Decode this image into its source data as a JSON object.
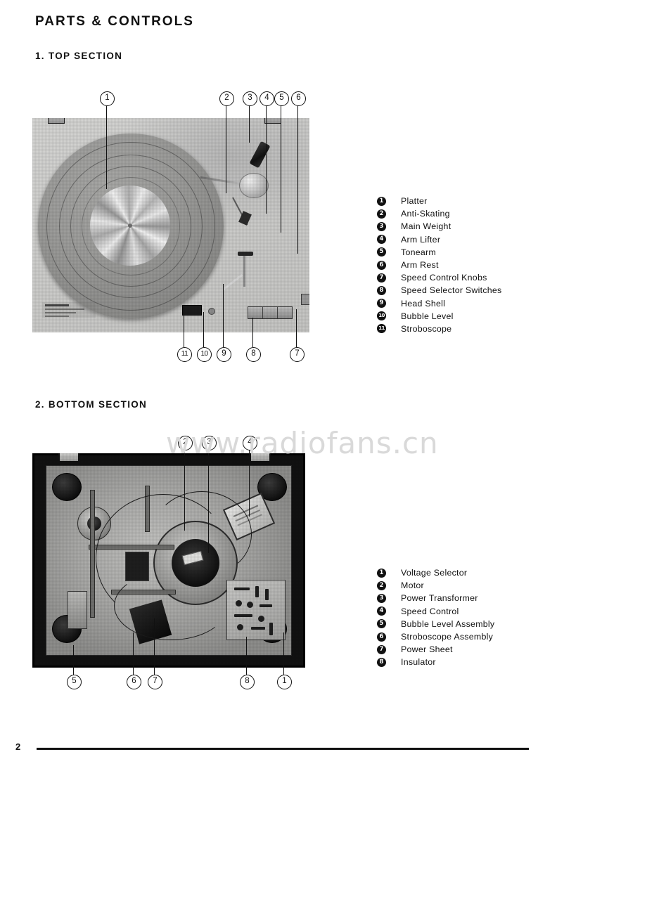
{
  "page": {
    "title": "PARTS & CONTROLS",
    "number": "2",
    "watermark": "www.radiofans.cn"
  },
  "sections": [
    {
      "heading": "1. TOP SECTION",
      "legend": [
        {
          "num": "1",
          "label": "Platter"
        },
        {
          "num": "2",
          "label": "Anti-Skating"
        },
        {
          "num": "3",
          "label": "Main Weight"
        },
        {
          "num": "4",
          "label": "Arm  Lifter"
        },
        {
          "num": "5",
          "label": "Tonearm"
        },
        {
          "num": "6",
          "label": "Arm  Rest"
        },
        {
          "num": "7",
          "label": "Speed Control Knobs"
        },
        {
          "num": "8",
          "label": "Speed Selector Switches"
        },
        {
          "num": "9",
          "label": "Head Shell"
        },
        {
          "num": "10",
          "label": "Bubble  Level"
        },
        {
          "num": "11",
          "label": "Stroboscope"
        }
      ],
      "callouts_top": [
        "1",
        "2",
        "3",
        "4",
        "5",
        "6"
      ],
      "callouts_bottom": [
        "11",
        "10",
        "9",
        "8",
        "7"
      ]
    },
    {
      "heading": "2. BOTTOM SECTION",
      "legend": [
        {
          "num": "1",
          "label": "Voltage Selector"
        },
        {
          "num": "2",
          "label": "Motor"
        },
        {
          "num": "3",
          "label": "Power  Transformer"
        },
        {
          "num": "4",
          "label": "Speed  Control"
        },
        {
          "num": "5",
          "label": "Bubble  Level  Assembly"
        },
        {
          "num": "6",
          "label": "Stroboscope  Assembly"
        },
        {
          "num": "7",
          "label": "Power  Sheet"
        },
        {
          "num": "8",
          "label": "Insulator"
        }
      ],
      "callouts_top": [
        "2",
        "3",
        "4"
      ],
      "callouts_bottom": [
        "5",
        "6",
        "7",
        "8",
        "1"
      ]
    }
  ]
}
